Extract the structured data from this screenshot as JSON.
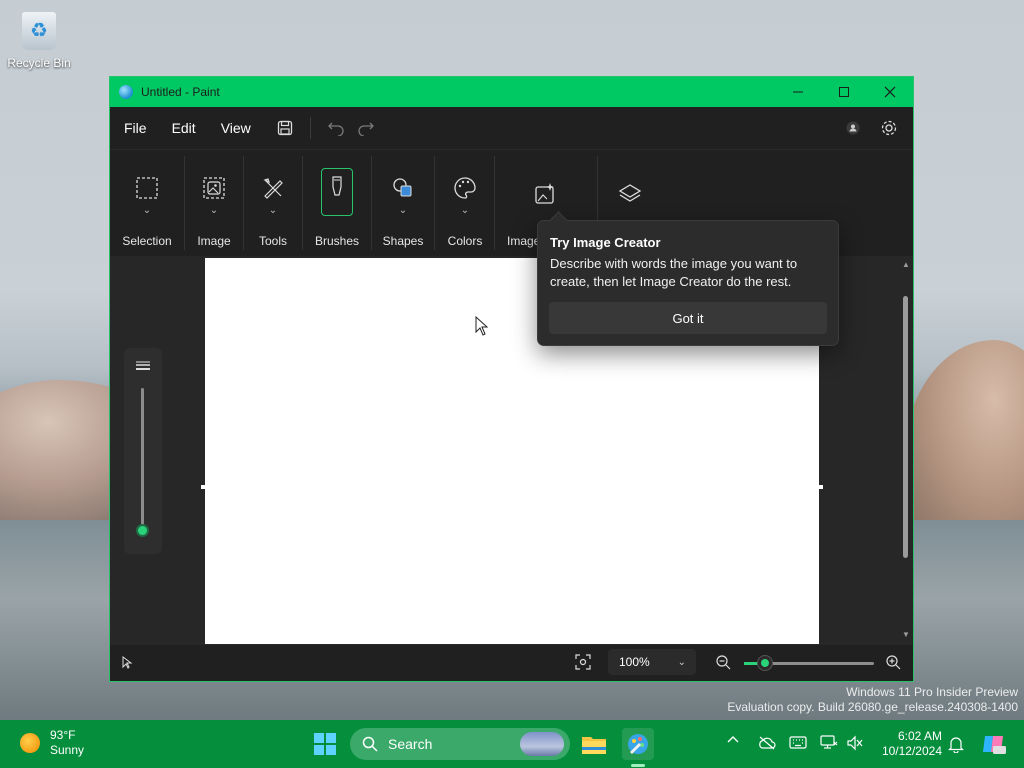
{
  "desktop": {
    "recycle_bin_label": "Recycle Bin",
    "watermark_line1": "Windows 11 Pro Insider Preview",
    "watermark_line2": "Evaluation copy. Build 26080.ge_release.240308-1400"
  },
  "window": {
    "title": "Untitled - Paint",
    "menu": [
      "File",
      "Edit",
      "View"
    ],
    "ribbon_groups": [
      {
        "label": "Selection",
        "icon": "selection-rect-icon"
      },
      {
        "label": "Image",
        "icon": "image-icon"
      },
      {
        "label": "Tools",
        "icon": "tools-icon"
      },
      {
        "label": "Brushes",
        "icon": "brush-icon"
      },
      {
        "label": "Shapes",
        "icon": "shapes-icon"
      },
      {
        "label": "Colors",
        "icon": "palette-icon"
      },
      {
        "label": "Image",
        "icon": "image-creator-icon"
      },
      {
        "label": "",
        "icon": "layers-icon"
      }
    ],
    "accent_color": "#00c862"
  },
  "popup": {
    "title": "Try Image Creator",
    "description": "Describe with words the image you want to create, then let Image Creator do the rest.",
    "button": "Got it"
  },
  "statusbar": {
    "zoom": "100%",
    "zoom_level": 0.08
  },
  "taskbar": {
    "weather_temp": "93°F",
    "weather_desc": "Sunny",
    "search_placeholder": "Search",
    "time": "6:02 AM",
    "date": "10/12/2024"
  }
}
